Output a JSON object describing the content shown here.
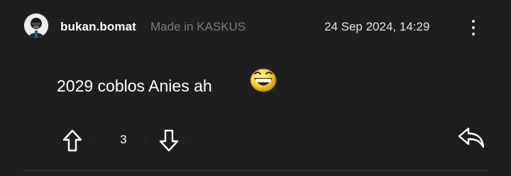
{
  "post": {
    "author": "bukan.bomat",
    "made_in": "Made in KASKUS",
    "timestamp": "24 Sep 2024, 14:29",
    "body_text": "2029 coblos Anies ah",
    "emoji": "laughing-smiley-icon",
    "vote_count": "3"
  },
  "icons": {
    "avatar": "avatar",
    "more": "more-vertical-icon",
    "upvote": "arrow-up-icon",
    "downvote": "arrow-down-icon",
    "reply": "reply-icon"
  },
  "colors": {
    "background": "#1e1e1e",
    "text_primary": "#ffffff",
    "text_muted": "#7d7d7d",
    "divider": "#3c3c3c"
  }
}
